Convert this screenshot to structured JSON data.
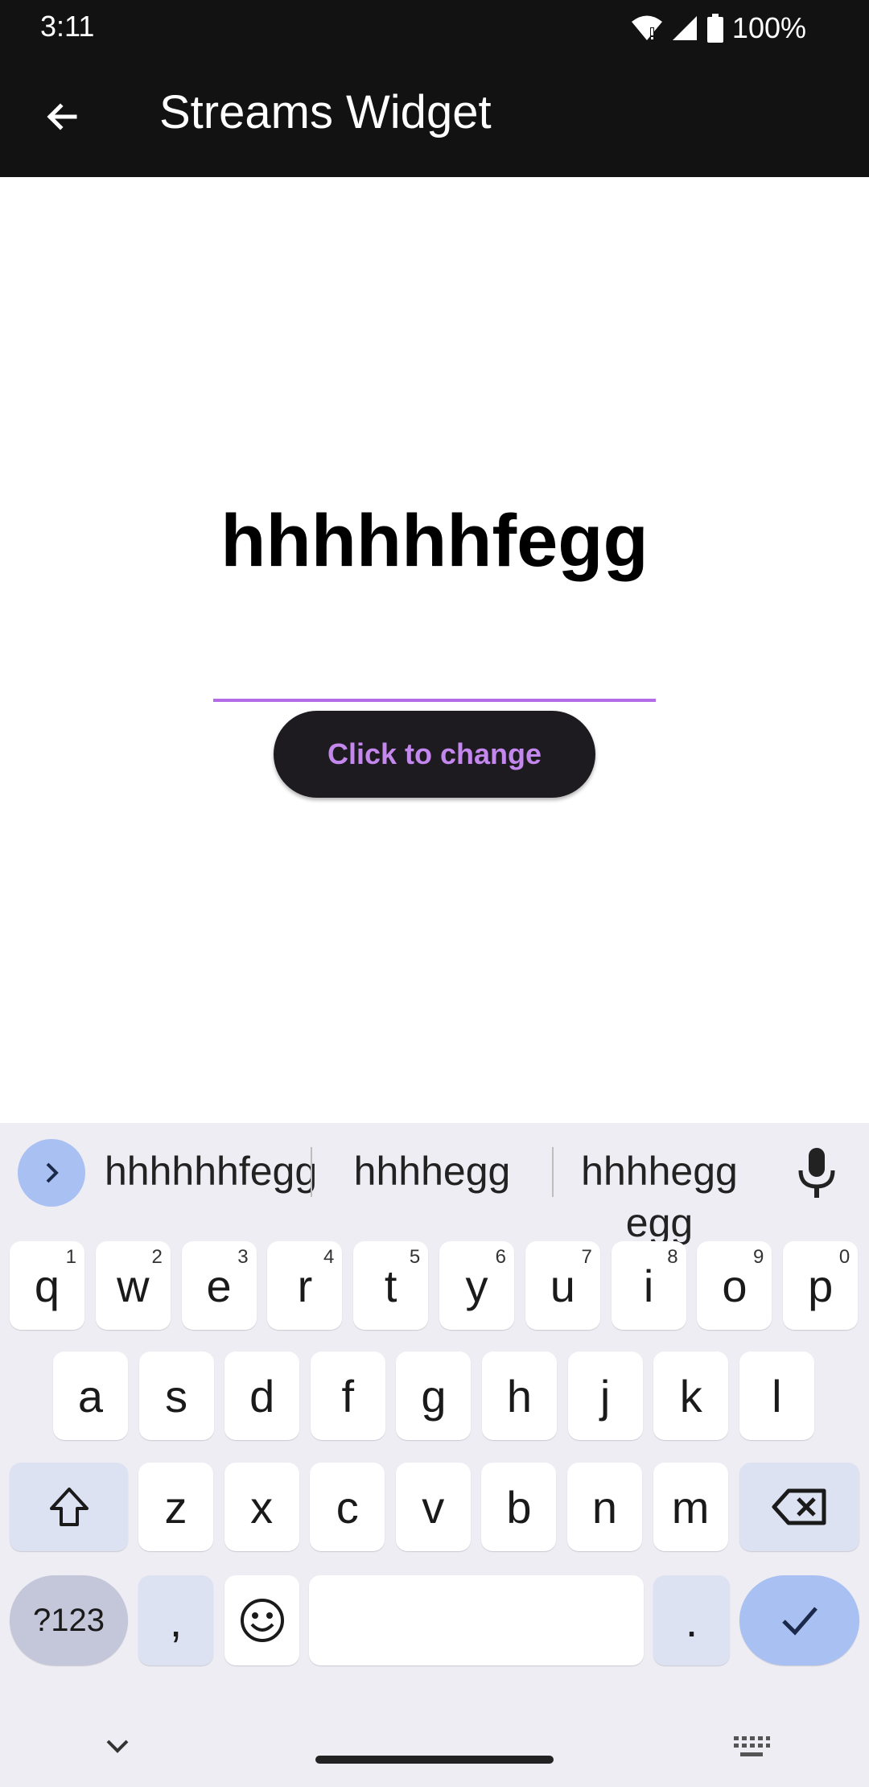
{
  "status_bar": {
    "time": "3:11",
    "battery": "100%"
  },
  "app_bar": {
    "title": "Streams Widget"
  },
  "main": {
    "display_text": "hhhhhhfegg",
    "button_label": "Click to change",
    "accent_color": "#b36be6"
  },
  "keyboard": {
    "suggestions": [
      "hhhhhhfegg",
      "hhhhegg",
      "hhhhegg egg"
    ],
    "row1": [
      {
        "key": "q",
        "hint": "1"
      },
      {
        "key": "w",
        "hint": "2"
      },
      {
        "key": "e",
        "hint": "3"
      },
      {
        "key": "r",
        "hint": "4"
      },
      {
        "key": "t",
        "hint": "5"
      },
      {
        "key": "y",
        "hint": "6"
      },
      {
        "key": "u",
        "hint": "7"
      },
      {
        "key": "i",
        "hint": "8"
      },
      {
        "key": "o",
        "hint": "9"
      },
      {
        "key": "p",
        "hint": "0"
      }
    ],
    "row2": [
      "a",
      "s",
      "d",
      "f",
      "g",
      "h",
      "j",
      "k",
      "l"
    ],
    "row3": [
      "z",
      "x",
      "c",
      "v",
      "b",
      "n",
      "m"
    ],
    "symbols_label": "?123",
    "comma": ",",
    "period": "."
  }
}
